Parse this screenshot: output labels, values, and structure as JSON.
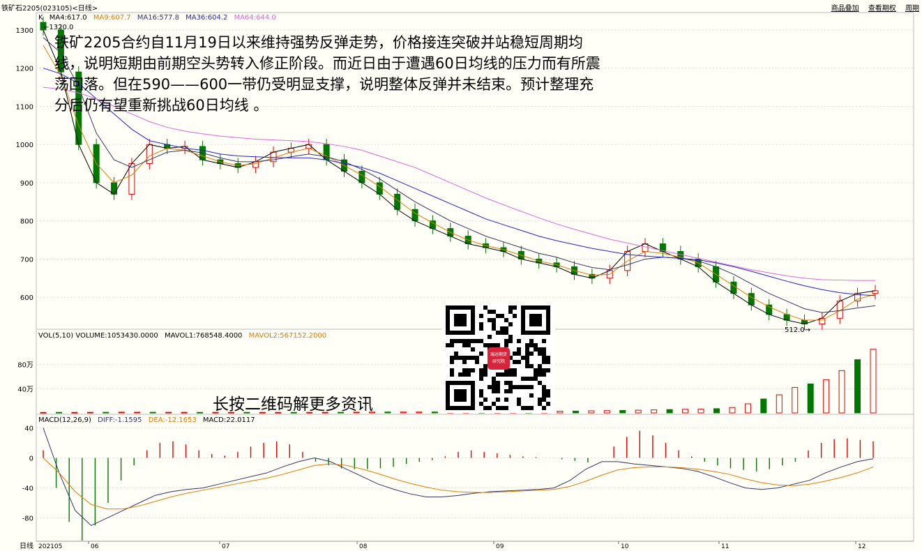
{
  "header": {
    "title": "铁矿石2205(023105)<日线>",
    "links": [
      "商品叠加",
      "查看期权",
      "周期"
    ]
  },
  "price_panel": {
    "legend": [
      {
        "text": "K",
        "color": "#000000"
      },
      {
        "text": "MA4:617.0",
        "color": "#000000"
      },
      {
        "text": "MA9:607.7",
        "color": "#e07b00"
      },
      {
        "text": "MA16:577.8",
        "color": "#333366"
      },
      {
        "text": "MA36:604.2",
        "color": "#2222cc"
      },
      {
        "text": "MA64:644.0",
        "color": "#dd66dd"
      }
    ],
    "high_mark": "1320.0",
    "low_mark": "512.0",
    "y_ticks": [
      "1300",
      "1200",
      "1100",
      "1000",
      "900",
      "800",
      "700",
      "600"
    ]
  },
  "volume_panel": {
    "legend": [
      {
        "text": "VOL(5,10) VOLUME:1053430.0000",
        "color": "#000000"
      },
      {
        "text": "MAVOL1:768548.4000",
        "color": "#000000"
      },
      {
        "text": "MAVOL2:567152.2000",
        "color": "#e07b00"
      }
    ],
    "y_ticks": [
      "80万",
      "40万"
    ]
  },
  "macd_panel": {
    "legend": [
      {
        "text": "MACD(12,26,9)",
        "color": "#000000"
      },
      {
        "text": "DIFF:-1.1595",
        "color": "#333366"
      },
      {
        "text": "DEA:-12.1653",
        "color": "#e07b00"
      },
      {
        "text": "MACD:22.0117",
        "color": "#000000"
      }
    ],
    "y_ticks": [
      "40",
      "0",
      "-40",
      "-80"
    ]
  },
  "x_axis": {
    "period_label": "日线",
    "labels": [
      "202105",
      "06",
      "07",
      "08",
      "09",
      "10",
      "11",
      "12"
    ]
  },
  "overlay_text": "铁矿2205合约自11月19日以来维持强势反弹走势，价格接连突破并站稳短周期均线，说明短期由前期空头势转入修正阶段。而近日由于遭遇60日均线的压力而有所震荡回落。但在590——600一带仍受明显支撑，说明整体反弹并未结束。预计整理充分后仍有望重新挑战60日均线 。",
  "qr": {
    "center_label_1": "瑞达期货",
    "center_label_2": "研究院"
  },
  "caption": "长按二维码解更多资讯",
  "colors": {
    "up": "#dd0000",
    "down": "#007700",
    "background": "#fffff7",
    "grid": "#dddddd"
  },
  "chart_data": [
    {
      "type": "line",
      "title": "铁矿石2205(023105)<日线>",
      "series": [
        {
          "name": "MA4",
          "values": [
            1300,
            1190,
            1000,
            900,
            870,
            950,
            1000,
            990,
            995,
            960,
            950,
            940,
            955,
            980,
            990,
            1000,
            960,
            930,
            900,
            870,
            830,
            800,
            780,
            760,
            740,
            730,
            720,
            700,
            690,
            680,
            660,
            650,
            670,
            720,
            740,
            720,
            700,
            680,
            640,
            610,
            580,
            555,
            540,
            530,
            545,
            590,
            610,
            617
          ]
        },
        {
          "name": "MA9",
          "values": [
            1260,
            1180,
            1050,
            950,
            900,
            920,
            970,
            990,
            985,
            970,
            955,
            945,
            950,
            965,
            980,
            990,
            970,
            945,
            920,
            890,
            855,
            820,
            795,
            770,
            750,
            735,
            725,
            710,
            695,
            685,
            670,
            658,
            660,
            695,
            720,
            715,
            705,
            690,
            660,
            630,
            600,
            575,
            555,
            540,
            540,
            565,
            595,
            607.7
          ]
        },
        {
          "name": "MA16",
          "values": [
            1280,
            1240,
            1150,
            1030,
            960,
            940,
            960,
            980,
            985,
            978,
            965,
            955,
            955,
            960,
            968,
            975,
            968,
            955,
            935,
            910,
            880,
            850,
            825,
            800,
            780,
            760,
            745,
            730,
            715,
            705,
            690,
            678,
            672,
            685,
            700,
            705,
            702,
            695,
            680,
            660,
            635,
            610,
            590,
            570,
            560,
            565,
            572,
            577.8
          ]
        },
        {
          "name": "MA36",
          "values": [
            1200,
            1185,
            1160,
            1120,
            1080,
            1040,
            1010,
            1000,
            990,
            985,
            975,
            970,
            968,
            966,
            965,
            965,
            960,
            950,
            940,
            925,
            905,
            885,
            865,
            845,
            825,
            805,
            790,
            775,
            760,
            748,
            738,
            728,
            720,
            712,
            708,
            705,
            702,
            698,
            690,
            680,
            668,
            655,
            642,
            630,
            620,
            612,
            607,
            604.2
          ]
        },
        {
          "name": "MA64",
          "values": [
            1150,
            1145,
            1135,
            1120,
            1100,
            1080,
            1060,
            1045,
            1035,
            1028,
            1022,
            1018,
            1014,
            1012,
            1010,
            1008,
            1002,
            995,
            985,
            970,
            955,
            940,
            920,
            900,
            880,
            860,
            842,
            825,
            808,
            792,
            778,
            765,
            752,
            742,
            732,
            722,
            712,
            702,
            692,
            682,
            672,
            664,
            656,
            650,
            646,
            645,
            644,
            644
          ]
        }
      ],
      "ylim": [
        520,
        1320
      ],
      "annotations": [
        "1320.0",
        "512.0"
      ]
    },
    {
      "type": "bar",
      "title": "VOL(5,10)",
      "series": [
        {
          "name": "VOLUME",
          "values": [
            8000,
            9000,
            8500,
            9500,
            10000,
            12000,
            11000,
            10500,
            9800,
            9500,
            9000,
            9200,
            9400,
            9100,
            8900,
            8700,
            8500,
            9000,
            9500,
            10000,
            12000,
            14000,
            15000,
            14500,
            14000,
            15000,
            16000,
            17000,
            18000,
            20000,
            22000,
            24000,
            26000,
            28000,
            30000,
            35000,
            38000,
            40000,
            45000,
            50000,
            55000,
            60000,
            62000,
            70000,
            90000,
            150000,
            230000,
            300000,
            420000,
            480000,
            550000,
            700000,
            880000,
            1053430
          ]
        }
      ],
      "ylim": [
        0,
        1200000
      ]
    },
    {
      "type": "bar",
      "title": "MACD(12,26,9)",
      "series": [
        {
          "name": "MACD",
          "values": [
            10,
            -40,
            -85,
            -110,
            -90,
            -60,
            -30,
            -10,
            10,
            20,
            22,
            18,
            10,
            5,
            3,
            8,
            15,
            20,
            22,
            18,
            8,
            -5,
            -10,
            -14,
            -15,
            -15,
            -14,
            -12,
            -8,
            -5,
            -3,
            2,
            8,
            10,
            8,
            6,
            4,
            2,
            1,
            0,
            -2,
            -4,
            -6,
            0,
            15,
            28,
            36,
            30,
            20,
            10,
            2,
            -5,
            -10,
            -14,
            -16,
            -18,
            -15,
            -10,
            -5,
            10,
            20,
            25,
            26,
            24,
            22.0117
          ]
        },
        {
          "name": "DIFF",
          "values": [
            40,
            -20,
            -70,
            -90,
            -80,
            -70,
            -60,
            -50,
            -45,
            -42,
            -40,
            -35,
            -30,
            -25,
            -20,
            -12,
            -5,
            0,
            -5,
            -15,
            -25,
            -35,
            -42,
            -48,
            -52,
            -52,
            -50,
            -47,
            -45,
            -44,
            -43,
            -42,
            -40,
            -30,
            -15,
            -5,
            -5,
            -8,
            -10,
            -12,
            -14,
            -18,
            -25,
            -33,
            -40,
            -42,
            -40,
            -35,
            -30,
            -20,
            -12,
            -5,
            -1.1595
          ]
        },
        {
          "name": "DEA",
          "values": [
            0,
            -20,
            -45,
            -62,
            -68,
            -68,
            -64,
            -58,
            -52,
            -47,
            -43,
            -39,
            -35,
            -31,
            -27,
            -22,
            -16,
            -10,
            -8,
            -10,
            -15,
            -21,
            -28,
            -34,
            -39,
            -43,
            -45,
            -46,
            -46,
            -45,
            -44,
            -43,
            -42,
            -38,
            -31,
            -23,
            -16,
            -13,
            -12,
            -12,
            -13,
            -15,
            -18,
            -22,
            -28,
            -33,
            -36,
            -37,
            -35,
            -31,
            -26,
            -20,
            -12.1653
          ]
        }
      ],
      "ylim": [
        -110,
        45
      ]
    }
  ]
}
